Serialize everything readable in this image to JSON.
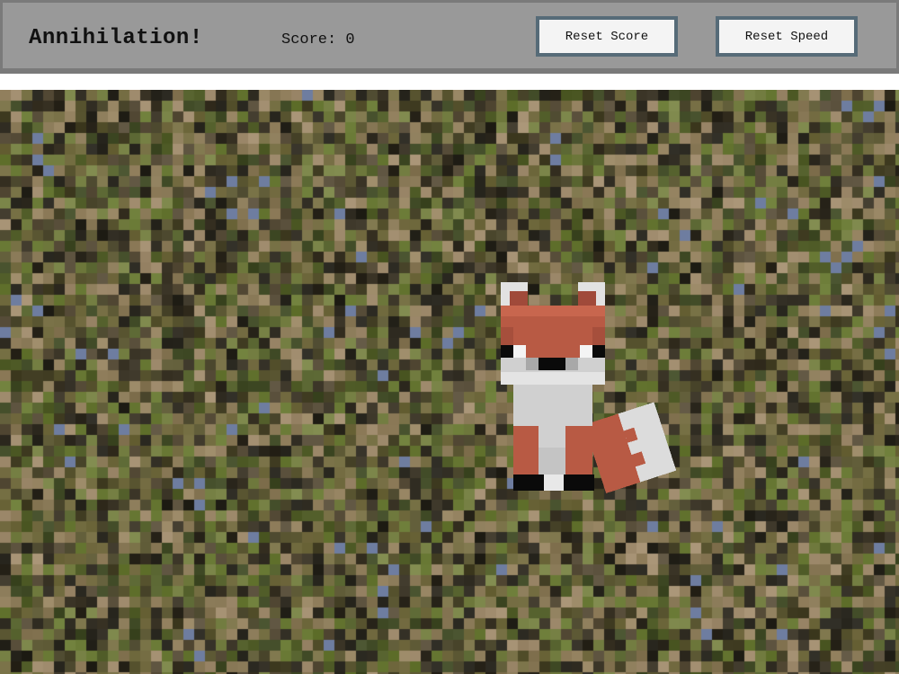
{
  "header": {
    "title": "Annihilation!",
    "score_text": "Score: 0",
    "reset_score_label": "Reset Score",
    "reset_speed_label": "Reset Speed"
  },
  "colors": {
    "bar_outer": "#7a7a7a",
    "bar_inner": "#999999",
    "button_border": "#566b78",
    "button_bg": "#f4f4f4",
    "fox_orange": "#b85a44",
    "fox_white": "#d9d9d9",
    "fox_black": "#0a0a0a"
  },
  "game": {
    "target": "fox-sprite",
    "background": "pixelated-grass"
  }
}
